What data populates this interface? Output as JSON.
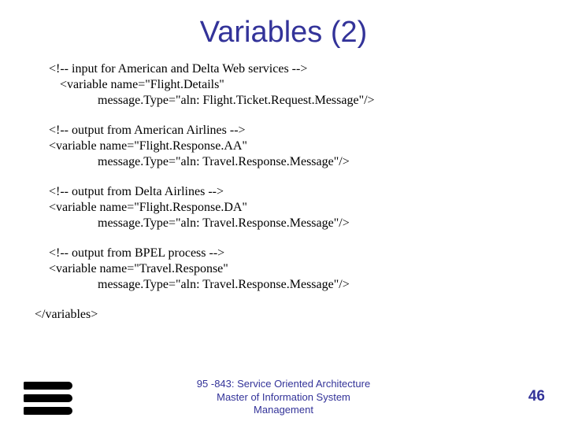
{
  "title": "Variables (2)",
  "blocks": [
    {
      "l1": "<!-- input for American and Delta Web services -->",
      "l2": "<variable name=\"Flight.Details\"",
      "l3": "message.Type=\"aln: Flight.Ticket.Request.Message\"/>"
    },
    {
      "l1": "<!-- output from American Airlines -->",
      "l2": "<variable name=\"Flight.Response.AA\"",
      "l3": "message.Type=\"aln: Travel.Response.Message\"/>"
    },
    {
      "l1": "<!-- output from Delta Airlines -->",
      "l2": "<variable name=\"Flight.Response.DA\"",
      "l3": "message.Type=\"aln: Travel.Response.Message\"/>"
    },
    {
      "l1": "<!-- output from BPEL process -->",
      "l2": "<variable name=\"Travel.Response\"",
      "l3": "message.Type=\"aln: Travel.Response.Message\"/>"
    }
  ],
  "closing": "</variables>",
  "footer": {
    "line1": "95 -843: Service Oriented Architecture",
    "line2": "Master of Information System",
    "line3": "Management"
  },
  "page_number": "46"
}
